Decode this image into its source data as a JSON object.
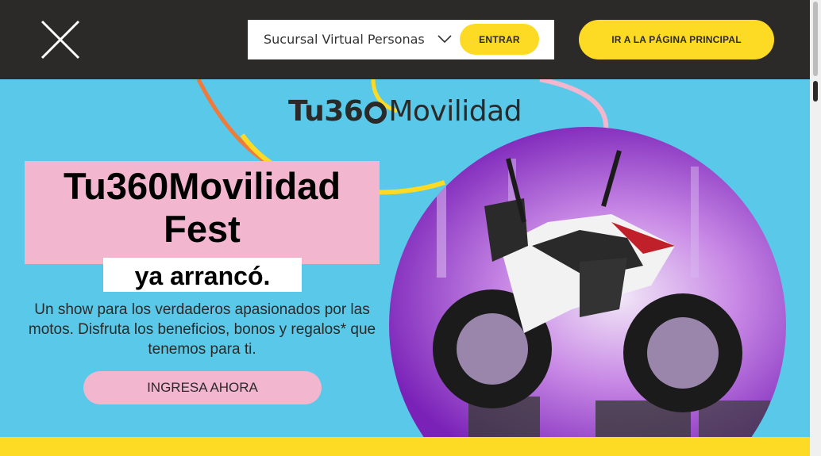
{
  "header": {
    "close_icon": "close-icon",
    "branch_select": {
      "value": "Sucursal Virtual Personas",
      "icon": "chevron-down-icon"
    },
    "login_button": "ENTRAR",
    "home_button": "IR A LA PÁGINA PRINCIPAL"
  },
  "hero": {
    "logo": {
      "bold": "Tu36",
      "ring_icon": "ring-icon",
      "light": "Movilidad"
    },
    "title_line1": "Tu360Movilidad",
    "title_line2": "Fest",
    "subtitle": "ya arrancó.",
    "description": "Un show para los verdaderos apasionados por las motos. Disfruta los beneficios, bonos y regalos* que tenemos para ti.",
    "cta_label": "INGRESA AHORA",
    "image": "motorcycle-photo"
  },
  "colors": {
    "header_bg": "#2b2a29",
    "accent_yellow": "#fdda24",
    "hero_bg": "#5ac8e8",
    "pink": "#f3b6cf"
  }
}
